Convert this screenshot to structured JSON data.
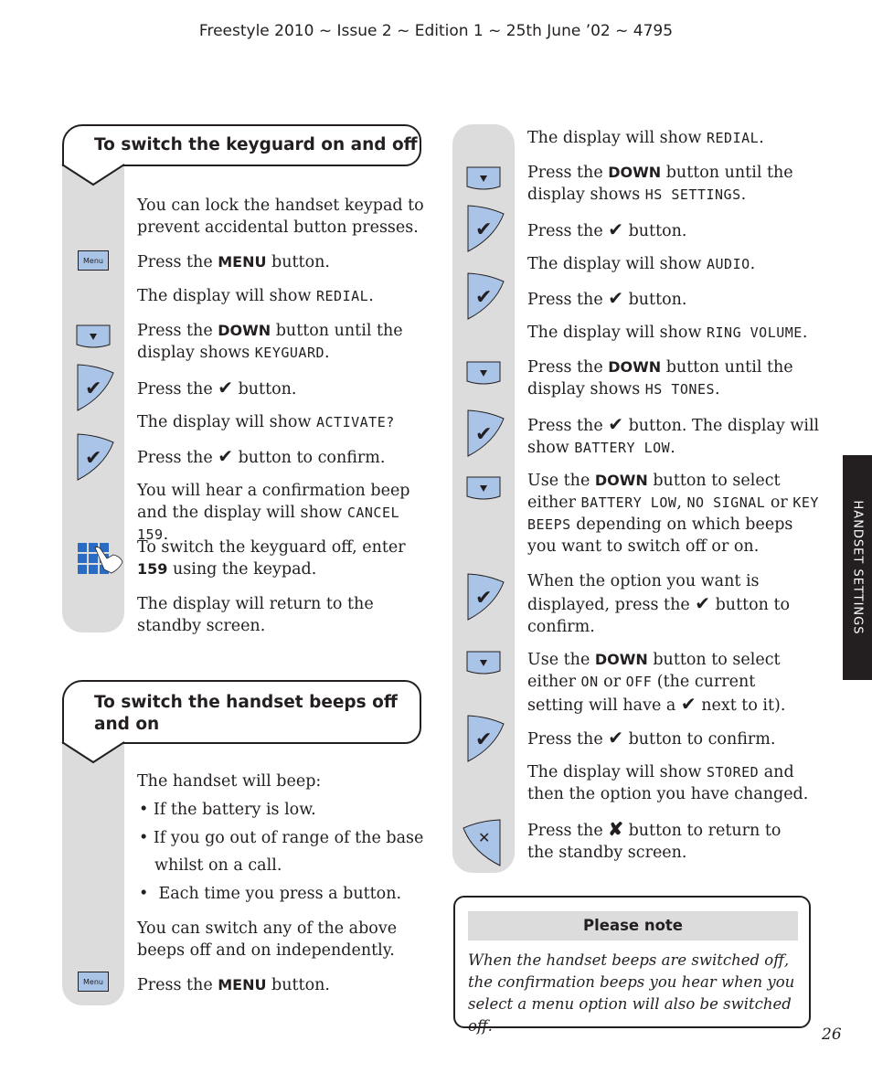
{
  "header": {
    "text": "Freestyle 2010 ~ Issue 2 ~ Edition 1 ~ 25th June ’02 ~ 4795"
  },
  "side_tab": {
    "label": "HANDSET SETTINGS"
  },
  "keyguard_section": {
    "title": "To switch the keyguard on and off",
    "intro": "You can lock the handset keypad to prevent accidental button presses.",
    "menu_icon_label": "Menu",
    "steps": {
      "s1": {
        "pre": "Press the ",
        "bold": "MENU",
        "post": " button."
      },
      "s2": {
        "pre": "The display will show ",
        "lcd": "REDIAL",
        "post": "."
      },
      "s3": {
        "pre": "Press the ",
        "bold": "DOWN",
        "mid": " button until the display shows ",
        "lcd": "KEYGUARD",
        "post": "."
      },
      "s4": {
        "pre": "Press the ",
        "check": "✔",
        "post": " button."
      },
      "s5": {
        "pre": "The display will show ",
        "lcd": "ACTIVATE?",
        "post": ""
      },
      "s6": {
        "pre": "Press the ",
        "check": "✔",
        "post": " button to confirm."
      },
      "s7": {
        "pre": "You will hear a confirmation beep and the display will show ",
        "lcd": "CANCEL 159",
        "post": "."
      },
      "s8": {
        "pre": "To switch the keyguard off, enter ",
        "bold": "159",
        "post": " using the keypad."
      },
      "s9": {
        "text": "The display will return to the standby screen."
      }
    }
  },
  "beeps_section": {
    "title_line1": "To switch the handset beeps off",
    "title_line2": "and on",
    "intro": "The handset will beep:",
    "bullets": [
      "If the battery is low.",
      "If you go out of range of the base",
      "whilst on a call.",
      "Each time you press a button."
    ],
    "independent": "You can switch any of the above beeps off and on independently.",
    "menu_icon_label": "Menu",
    "menu_step": {
      "pre": "Press the ",
      "bold": "MENU",
      "post": " button."
    }
  },
  "beeps_continued": {
    "steps": {
      "r1": {
        "pre": "The display will show ",
        "lcd": "REDIAL",
        "post": "."
      },
      "r2": {
        "pre": "Press the ",
        "bold": "DOWN",
        "mid": " button until the display shows ",
        "lcd": "HS SETTINGS",
        "post": "."
      },
      "r3": {
        "pre": "Press the ",
        "check": "✔",
        "post": " button."
      },
      "r4": {
        "pre": "The display will show ",
        "lcd": "AUDIO",
        "post": "."
      },
      "r5": {
        "pre": "Press the ",
        "check": "✔",
        "post": " button."
      },
      "r6": {
        "pre": "The display will show ",
        "lcd": "RING VOLUME",
        "post": "."
      },
      "r7": {
        "pre": "Press the ",
        "bold": "DOWN",
        "mid": " button until the display shows ",
        "lcd": "HS TONES",
        "post": "."
      },
      "r8": {
        "pre": "Press the ",
        "check": "✔",
        "mid": " button. The display will show ",
        "lcd": "BATTERY LOW",
        "post": "."
      },
      "r9": {
        "pre": "Use the ",
        "bold": "DOWN",
        "mid": " button to select either ",
        "lcd1": "BATTERY LOW",
        "sep1": ", ",
        "lcd2": "NO SIGNAL",
        "sep2": " or ",
        "lcd3": "KEY BEEPS",
        "post": " depending on which beeps you want to switch off or on."
      },
      "r10": {
        "pre": "When the option you want is displayed, press the ",
        "check": "✔",
        "post": " button to confirm."
      },
      "r11": {
        "pre": "Use the ",
        "bold": "DOWN",
        "mid": " button to select either ",
        "lcd1": "ON",
        "sep1": " or ",
        "lcd2": "OFF",
        "mid2": "  (the current setting will have a ",
        "check": "✔",
        "post": " next to it)."
      },
      "r12": {
        "pre": "Press the ",
        "check": "✔",
        "post": " button to confirm."
      },
      "r13": {
        "pre": "The display will show ",
        "lcd": "STORED",
        "post": " and then the option you have changed."
      },
      "r14": {
        "pre": "Press the ",
        "cross": "✘",
        "post": " button to return to the standby screen."
      }
    }
  },
  "note": {
    "heading": "Please note",
    "body": "When the handset beeps are switched off, the confirmation beeps you hear when you select a menu option will also be switched off."
  },
  "page_number": "26",
  "colors": {
    "button_fill": "#aac4e8",
    "rail_gray": "#dcdcdc",
    "keypad_blue": "#2a6bc4",
    "ink": "#231f20"
  }
}
